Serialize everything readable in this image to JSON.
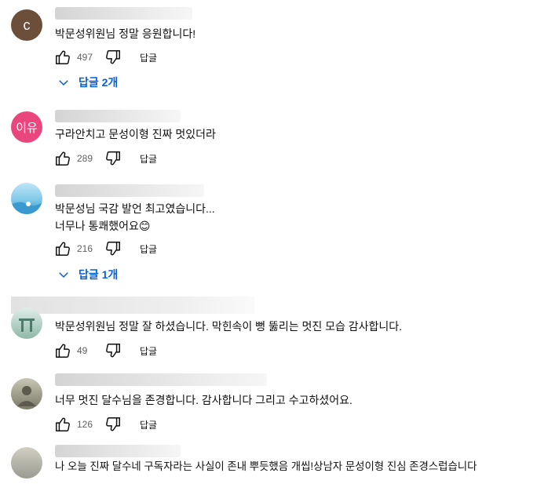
{
  "comments": [
    {
      "avatar_letter": "c",
      "avatar_color": "#6b4f3b",
      "text_lines": [
        "박문성위원님 정말 응원합니다!"
      ],
      "likes": "497",
      "reply_label": "답글",
      "replies_label": "답글 2개"
    },
    {
      "avatar_letter": "이유",
      "avatar_color": "#e8467c",
      "text_lines": [
        "구라안치고 문성이형 진짜 멋있더라"
      ],
      "likes": "289",
      "reply_label": "답글"
    },
    {
      "avatar_color": "#7fc8e8",
      "text_lines": [
        "박문성님 국감 발언 최고였습니다...",
        "너무나 통쾌했어요😊"
      ],
      "likes": "216",
      "reply_label": "답글",
      "replies_label": "답글 1개"
    },
    {
      "avatar_color": "#8fb8a8",
      "text_lines": [
        "박문성위원님 정말 잘 하셨습니다. 막힌속이 뻥 뚫리는 멋진 모습 감사합니다."
      ],
      "likes": "49",
      "reply_label": "답글"
    },
    {
      "avatar_color": "#7a7a6a",
      "text_lines": [
        "너무 멋진 달수님을 존경합니다. 감사합니다 그리고 수고하셨어요."
      ],
      "likes": "126",
      "reply_label": "답글"
    },
    {
      "avatar_color": "#9a9a90",
      "text_lines": [
        "나 오늘 진짜 달수네 구독자라는 사실이 존내 뿌듯했음 개씹!상남자 문성이형 진심 존경스럽습니다"
      ]
    }
  ]
}
